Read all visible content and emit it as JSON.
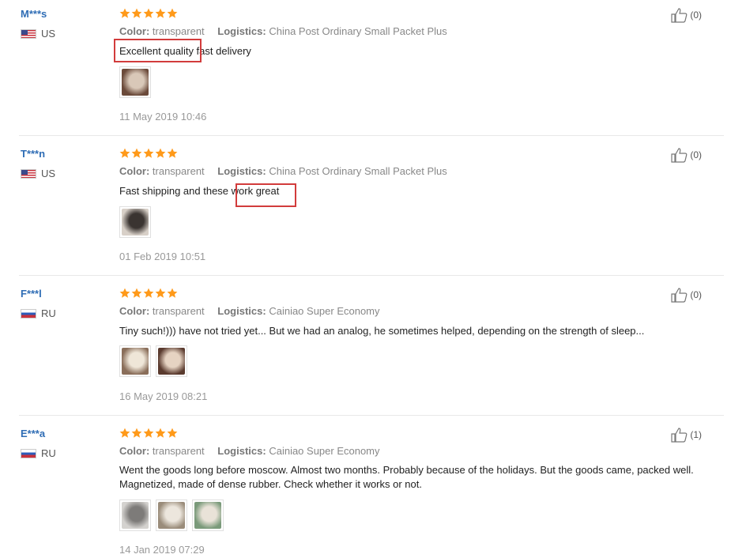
{
  "reviews": [
    {
      "user": "M***s",
      "country": "US",
      "flag": "us",
      "color_label": "Color:",
      "color": "transparent",
      "logistics_label": "Logistics:",
      "logistics": "China Post Ordinary Small Packet Plus",
      "text": "Excellent quality fast delivery",
      "images": [
        {
          "icon": "product-photo"
        }
      ],
      "date": "11 May 2019 10:46",
      "likes": "(0)"
    },
    {
      "user": "T***n",
      "country": "US",
      "flag": "us",
      "color_label": "Color:",
      "color": "transparent",
      "logistics_label": "Logistics:",
      "logistics": "China Post Ordinary Small Packet Plus",
      "text": "Fast shipping and these work great",
      "images": [
        {
          "icon": "product-photo"
        }
      ],
      "date": "01 Feb 2019 10:51",
      "likes": "(0)"
    },
    {
      "user": "F***l",
      "country": "RU",
      "flag": "ru",
      "color_label": "Color:",
      "color": "transparent",
      "logistics_label": "Logistics:",
      "logistics": "Cainiao Super Economy",
      "text": "Tiny such!))) have not tried yet... But we had an analog, he sometimes helped, depending on the strength of sleep...",
      "images": [
        {
          "icon": "product-photo"
        },
        {
          "icon": "product-photo"
        }
      ],
      "date": "16 May 2019 08:21",
      "likes": "(0)"
    },
    {
      "user": "E***a",
      "country": "RU",
      "flag": "ru",
      "color_label": "Color:",
      "color": "transparent",
      "logistics_label": "Logistics:",
      "logistics": "Cainiao Super Economy",
      "text": "Went the goods long before moscow. Almost two months. Probably because of the holidays. But the goods came, packed well. Magnetized, made of dense rubber. Check whether it works or not.",
      "images": [
        {
          "icon": "product-photo"
        },
        {
          "icon": "product-photo"
        },
        {
          "icon": "product-photo"
        }
      ],
      "date": "14 Jan 2019 07:29",
      "likes": "(1)"
    }
  ],
  "rating": {
    "stars": 5,
    "max": 5
  },
  "colors": {
    "star": "#ff9a1a",
    "username": "#2f6db5",
    "highlight": "#d23c3c"
  }
}
